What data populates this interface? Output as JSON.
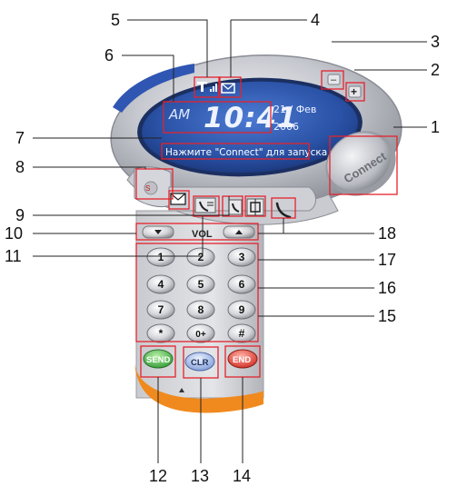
{
  "lcd": {
    "ampm": "AM",
    "time": "10:41",
    "date": "21 / Фев",
    "year": "2006",
    "status": "Нажмите \"Connect\" для запуска"
  },
  "buttons": {
    "connect": "Connect",
    "minimize": "–",
    "maximize": "+",
    "vol": "VOL",
    "send": "SEND",
    "clr": "CLR",
    "end": "END"
  },
  "keypad": [
    "1",
    "2",
    "3",
    "4",
    "5",
    "6",
    "7",
    "8",
    "9",
    "*",
    "0+",
    "#"
  ],
  "callouts": {
    "c1": "1",
    "c2": "2",
    "c3": "3",
    "c4": "4",
    "c5": "5",
    "c6": "6",
    "c7": "7",
    "c8": "8",
    "c9": "9",
    "c10": "10",
    "c11": "11",
    "c12": "12",
    "c13": "13",
    "c14": "14",
    "c15": "15",
    "c16": "16",
    "c17": "17",
    "c18": "18"
  },
  "icons": [
    "signal-icon",
    "mail-icon",
    "envelope-icon",
    "call-log-icon",
    "phonebook-icon",
    "settings-icon",
    "phone-icon",
    "volume-down-icon",
    "volume-up-icon"
  ],
  "colors": {
    "lcd_blue": "#2c55a8",
    "callout_red": "#e4232d",
    "send_green": "#4ab947",
    "clr_blue": "#aac3ec",
    "end_red": "#e84437",
    "orange": "#f08a1e"
  }
}
